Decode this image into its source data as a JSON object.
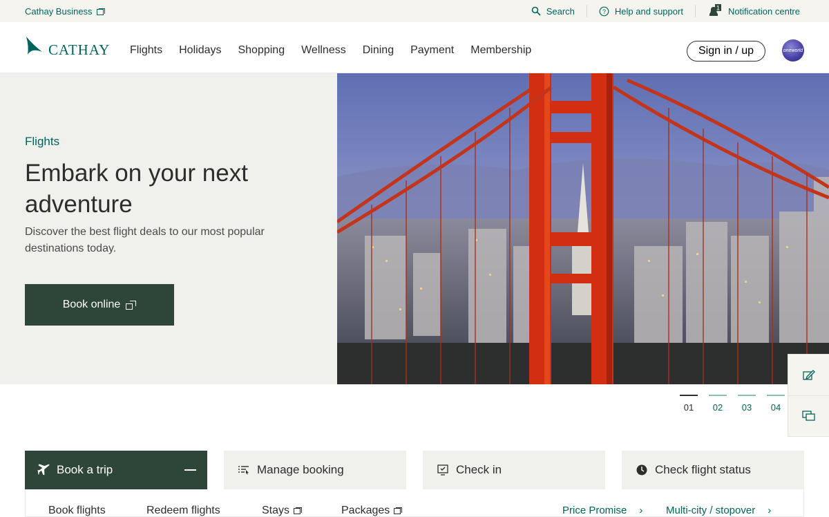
{
  "topbar": {
    "business_label": "Cathay Business",
    "search_label": "Search",
    "help_label": "Help and support",
    "notification_label": "Notification centre",
    "notification_count": "1"
  },
  "nav": {
    "logo_text": "CATHAY",
    "menu": [
      "Flights",
      "Holidays",
      "Shopping",
      "Wellness",
      "Dining",
      "Payment",
      "Membership"
    ],
    "signin_label": "Sign in / up",
    "alliance_label": "oneworld"
  },
  "hero": {
    "kicker": "Flights",
    "title": "Embark on your next adventure",
    "description": "Discover the best flight deals to our most popular destinations today.",
    "cta_label": "Book online"
  },
  "pager": {
    "pages": [
      "01",
      "02",
      "03",
      "04"
    ],
    "active": "01"
  },
  "tabs": [
    {
      "label": "Book a trip"
    },
    {
      "label": "Manage booking"
    },
    {
      "label": "Check in"
    },
    {
      "label": "Check flight status"
    }
  ],
  "subnav": {
    "book_flights": "Book flights",
    "redeem_flights": "Redeem flights",
    "stays": "Stays",
    "packages": "Packages",
    "price_promise": "Price Promise",
    "multi_city": "Multi-city / stopover"
  },
  "colors": {
    "brand_green": "#00645a",
    "dark_green": "#2e4638",
    "hero_panel": "#f0f0ec",
    "topbar_bg": "#f5f4ef"
  },
  "icons": {
    "search": "search-icon",
    "help": "help-icon",
    "notification": "bell-icon",
    "external": "external-link-icon",
    "plane": "plane-icon",
    "booking": "list-icon",
    "checkin": "checkin-icon",
    "status": "clock-icon",
    "feedback": "feedback-icon",
    "chat": "chat-icon"
  }
}
